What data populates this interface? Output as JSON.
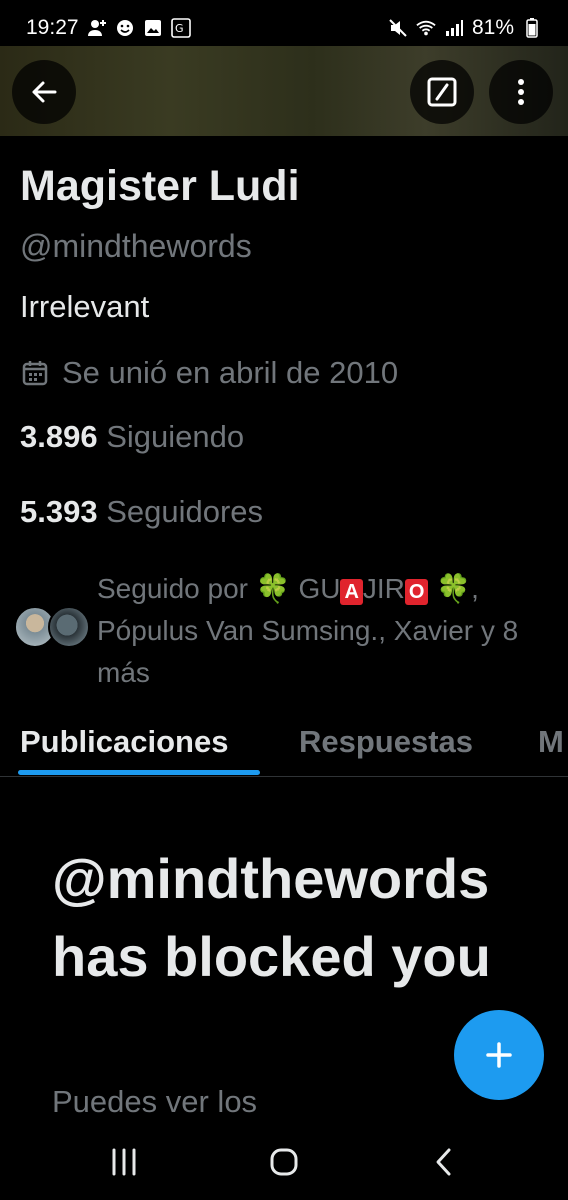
{
  "status_bar": {
    "time": "19:27",
    "battery": "81%",
    "icons": [
      "person-add-icon",
      "emoji-icon",
      "image-icon",
      "translate-icon",
      "mute-icon",
      "wifi-icon",
      "signal-icon",
      "battery-icon"
    ]
  },
  "header": {
    "back_icon": "arrow-left-icon",
    "edit_icon": "slash-square-icon",
    "more_icon": "more-vertical-icon"
  },
  "profile": {
    "name": "Magister Ludi",
    "handle": "@mindthewords",
    "bio": "Irrelevant",
    "joined_icon": "calendar-icon",
    "joined": "Se unió en abril de 2010",
    "following_count": "3.896",
    "following_label": "Siguiendo",
    "followers_count": "5.393",
    "followers_label": "Seguidores"
  },
  "followed_by": {
    "prefix": "Seguido por",
    "clover": "🍀",
    "name_part1": "GU",
    "badge_a": "A",
    "name_part2": "JIR",
    "badge_o": "O",
    "rest": ", Pópulus Van Sumsing., Xavier y 8 más"
  },
  "tabs": [
    {
      "label": "Publicaciones",
      "active": true
    },
    {
      "label": "Respuestas",
      "active": false
    },
    {
      "label": "M",
      "active": false
    }
  ],
  "blocked": {
    "title": "@mindthewords has blocked you",
    "subtitle": "Puedes ver los"
  },
  "fab": {
    "icon": "plus-icon"
  },
  "colors": {
    "accent": "#1d9bf0",
    "text": "#e7e9ea",
    "muted": "#71767b",
    "badge": "#e0242d"
  }
}
